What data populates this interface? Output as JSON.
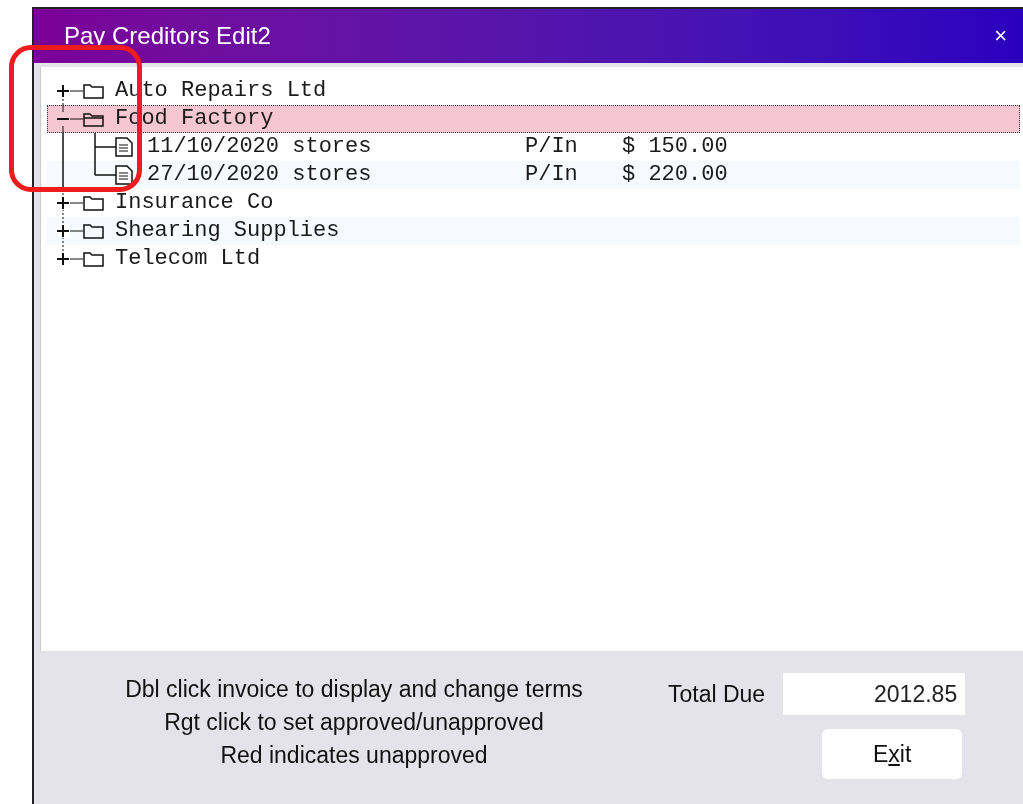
{
  "window": {
    "title": "Pay Creditors Edit2",
    "close": "×"
  },
  "tree": [
    {
      "label": "Auto Repairs Ltd",
      "expanded": false,
      "selected": false
    },
    {
      "label": "Food Factory",
      "expanded": true,
      "selected": true,
      "children": [
        {
          "description": "11/10/2020 stores",
          "type": "P/In",
          "amount": "$ 150.00",
          "selected": false
        },
        {
          "description": "27/10/2020 stores",
          "type": "P/In",
          "amount": "$ 220.00",
          "selected": false
        }
      ]
    },
    {
      "label": "Insurance Co",
      "expanded": false,
      "selected": false
    },
    {
      "label": "Shearing Supplies",
      "expanded": false,
      "selected": false
    },
    {
      "label": "Telecom Ltd",
      "expanded": false,
      "selected": false
    }
  ],
  "help_lines": [
    "Dbl click invoice to display and change terms",
    "Rgt click to set approved/unapproved",
    "Red indicates unapproved"
  ],
  "total_due": {
    "label": "Total Due",
    "value": "2012.85"
  },
  "exit_button": {
    "before": "E",
    "access_key": "x",
    "after": "it"
  }
}
